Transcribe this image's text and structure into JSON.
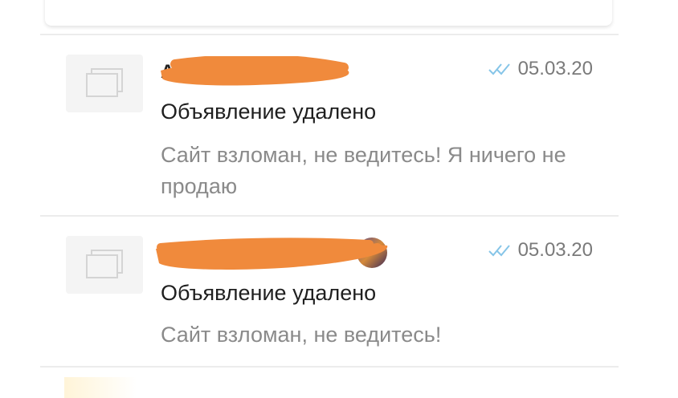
{
  "colors": {
    "checkmarks": "#86c5e8",
    "redaction": "#f08a3c",
    "title": "#1f1f1f",
    "message": "#8a8a8a",
    "date": "#7a7a7a"
  },
  "conversations": [
    {
      "sender_visible": "А",
      "title": "Объявление удалено",
      "message": "Сайт взломан, не ведитесь! Я ничего не продаю",
      "date": "05.03.20",
      "read_icon": "double-check-icon",
      "thumbnail_icon": "image-placeholder-icon"
    },
    {
      "sender_visible": "",
      "title": "Объявление удалено",
      "message": "Сайт взломан, не ведитесь!",
      "date": "05.03.20",
      "read_icon": "double-check-icon",
      "thumbnail_icon": "image-placeholder-icon"
    }
  ]
}
